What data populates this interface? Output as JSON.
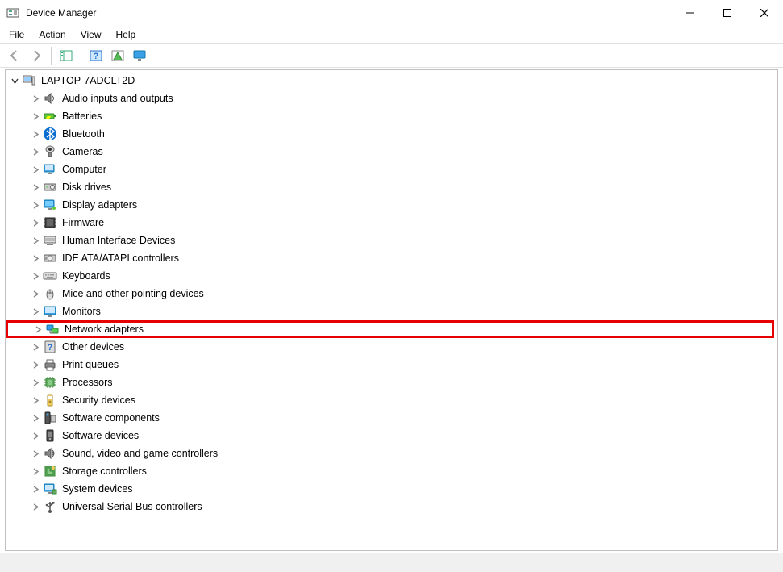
{
  "window": {
    "title": "Device Manager"
  },
  "menu": {
    "items": [
      "File",
      "Action",
      "View",
      "Help"
    ]
  },
  "toolbar": {
    "buttons": [
      {
        "name": "back-icon",
        "label": "Back",
        "disabled": true
      },
      {
        "name": "forward-icon",
        "label": "Forward",
        "disabled": true
      },
      {
        "name": "sep"
      },
      {
        "name": "show-hide-console-icon",
        "label": "Show/Hide Console Tree"
      },
      {
        "name": "sep"
      },
      {
        "name": "help-icon",
        "label": "Help"
      },
      {
        "name": "action-icon",
        "label": "Action"
      },
      {
        "name": "monitor-icon",
        "label": "Monitor"
      }
    ]
  },
  "tree": {
    "root": {
      "label": "LAPTOP-7ADCLT2D",
      "expanded": true
    },
    "children": [
      {
        "label": "Audio inputs and outputs",
        "icon": "audio-icon"
      },
      {
        "label": "Batteries",
        "icon": "battery-icon"
      },
      {
        "label": "Bluetooth",
        "icon": "bluetooth-icon"
      },
      {
        "label": "Cameras",
        "icon": "camera-icon"
      },
      {
        "label": "Computer",
        "icon": "computer-icon"
      },
      {
        "label": "Disk drives",
        "icon": "disk-icon"
      },
      {
        "label": "Display adapters",
        "icon": "display-icon"
      },
      {
        "label": "Firmware",
        "icon": "firmware-icon"
      },
      {
        "label": "Human Interface Devices",
        "icon": "hid-icon"
      },
      {
        "label": "IDE ATA/ATAPI controllers",
        "icon": "ide-icon"
      },
      {
        "label": "Keyboards",
        "icon": "keyboard-icon"
      },
      {
        "label": "Mice and other pointing devices",
        "icon": "mouse-icon"
      },
      {
        "label": "Monitors",
        "icon": "monitor-category-icon"
      },
      {
        "label": "Network adapters",
        "icon": "network-icon",
        "highlighted": true
      },
      {
        "label": "Other devices",
        "icon": "other-icon"
      },
      {
        "label": "Print queues",
        "icon": "printer-icon"
      },
      {
        "label": "Processors",
        "icon": "processor-icon"
      },
      {
        "label": "Security devices",
        "icon": "security-icon"
      },
      {
        "label": "Software components",
        "icon": "software-comp-icon"
      },
      {
        "label": "Software devices",
        "icon": "software-dev-icon"
      },
      {
        "label": "Sound, video and game controllers",
        "icon": "sound-icon"
      },
      {
        "label": "Storage controllers",
        "icon": "storage-icon"
      },
      {
        "label": "System devices",
        "icon": "system-icon"
      },
      {
        "label": "Universal Serial Bus controllers",
        "icon": "usb-icon"
      }
    ]
  }
}
